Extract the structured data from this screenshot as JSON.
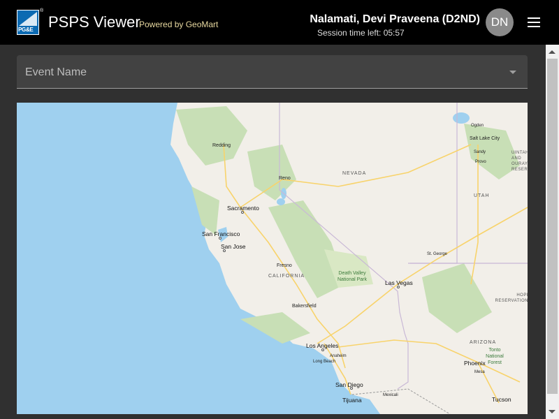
{
  "header": {
    "logo_text": "PG&E",
    "app_title": "PSPS Viewer",
    "powered_by": "Powered by GeoMart",
    "user_name": "Nalamati, Devi Praveena (D2ND)",
    "session_label": "Session time left: 05:57",
    "avatar_initials": "DN",
    "menu_icon": "hamburger-menu-icon"
  },
  "event_select": {
    "label": "Event Name",
    "icon": "chevron-down-icon"
  },
  "map": {
    "states": [
      "NEVADA",
      "CALIFORNIA",
      "UTAH",
      "ARIZONA"
    ],
    "cities": {
      "redding": "Redding",
      "reno": "Reno",
      "sacramento": "Sacramento",
      "san_francisco": "San Francisco",
      "san_jose": "San Jose",
      "fresno": "Fresno",
      "bakersfield": "Bakersfield",
      "los_angeles": "Los Angeles",
      "anaheim": "Anaheim",
      "long_beach": "Long Beach",
      "san_diego": "San Diego",
      "tijuana": "Tijuana",
      "mexicali": "Mexicali",
      "las_vegas": "Las Vegas",
      "st_george": "St. George",
      "salt_lake_city": "Salt Lake City",
      "ogden": "Ogden",
      "sandy": "Sandy",
      "provo": "Provo",
      "phoenix": "Phoenix",
      "mesa": "Mesa",
      "tucson": "Tucson"
    },
    "parks": {
      "death_valley": "Death Valley National Park",
      "tonto": "Tonto National Forest"
    },
    "reservations": {
      "hopi": "HOPI RESERVATION",
      "uintah": "UINTAH AND OURAY RESERVATION"
    },
    "colors": {
      "water": "#9fd0ef",
      "land": "#f2efe9",
      "forest": "#c8dfb6",
      "highway": "#f8d36b"
    }
  }
}
